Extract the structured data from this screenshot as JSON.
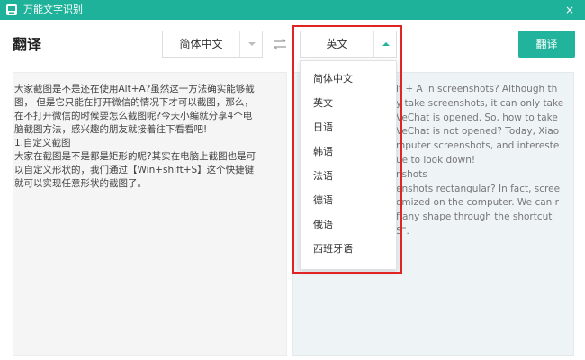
{
  "window": {
    "title": "万能文字识别",
    "close_glyph": "×"
  },
  "page_title": "翻译",
  "source_select": {
    "value": "简体中文"
  },
  "target_select": {
    "value": "英文"
  },
  "translate_button": "翻译",
  "language_options": [
    "简体中文",
    "英文",
    "日语",
    "韩语",
    "法语",
    "德语",
    "俄语",
    "西班牙语"
  ],
  "source_text": "大家截图是不是还在使用Alt+A?虽然这一方法确实能够截\n图，  但是它只能在打开微信的情况下才可以截图，那么，\n在不打开微信的时候要怎么截图呢?今天小编就分享4个电\n脑截图方法，感兴趣的朋友就接着往下看看吧!\n1.自定义截图\n大家在截图是不是都是矩形的呢?其实在电脑上截图也是可\n以自定义形状的，我们通过【Win+shift+S】这个快捷键\n就可以实现任意形状的截图了。",
  "target_text": "lt + A in screenshots? Although th\ny take screenshots, it can only take\nVeChat is opened. So, how to take\nVeChat is not opened? Today, Xiao\nmputer screenshots, and intereste\nue to look down!\nnshots\nenshots rectangular? In fact, scree\nomized on the computer. We can r\nf any shape through the shortcut\nS\".",
  "colors": {
    "accent": "#21b39c",
    "titlebar": "#1fb29a",
    "highlight": "#e02323"
  }
}
